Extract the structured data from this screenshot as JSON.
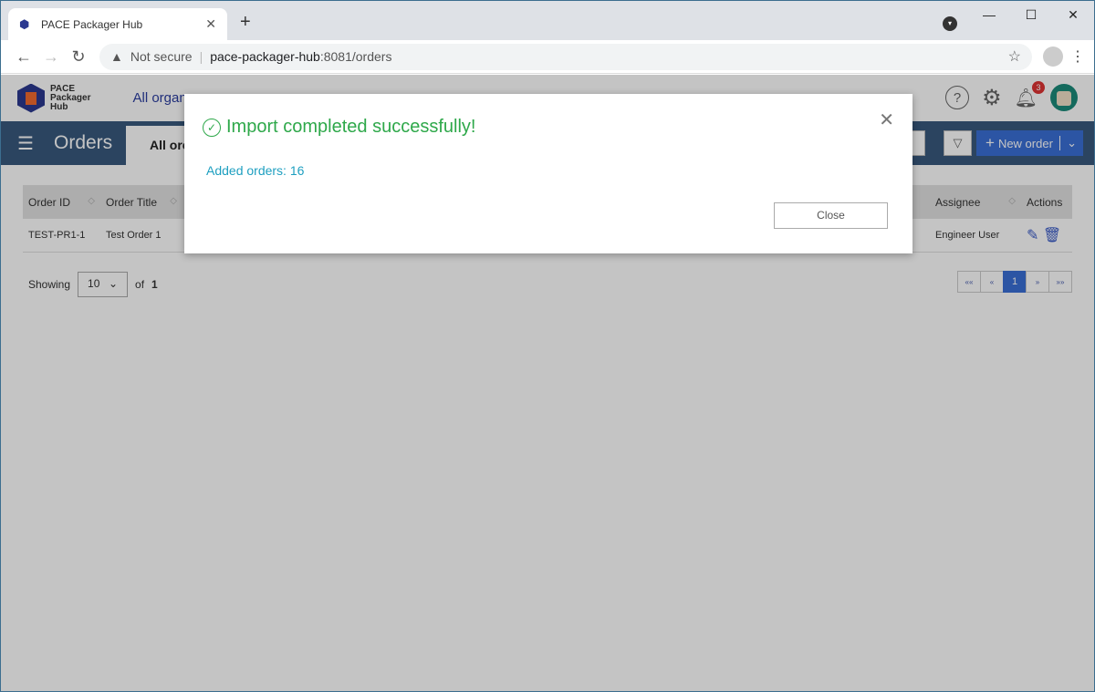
{
  "browser": {
    "tab_title": "PACE Packager Hub",
    "not_secure": "Not secure",
    "url_host": "pace-packager-hub",
    "url_rest": ":8081/orders"
  },
  "app": {
    "logo_line1": "PACE",
    "logo_line2": "Packager",
    "logo_line3": "Hub",
    "org_selector": "All organ",
    "notification_count": "3",
    "page_title": "Orders",
    "tab_all": "All orc",
    "new_order": "New order"
  },
  "table": {
    "headers": [
      "Order ID",
      "Order Title",
      "Assignee",
      "Actions"
    ],
    "rows": [
      {
        "id": "TEST-PR1-1",
        "title": "Test Order 1",
        "assignee": "Engineer User"
      }
    ]
  },
  "footer": {
    "showing": "Showing",
    "page_size": "10",
    "of": "of",
    "total_pages": "1"
  },
  "pager": {
    "first": "««",
    "prev": "«",
    "current": "1",
    "next": "»",
    "last": "»»"
  },
  "modal": {
    "title": "Import completed successfully!",
    "message": "Added orders: 16",
    "close": "Close"
  },
  "colors": {
    "success": "#2ea84a",
    "info": "#1e9fc0",
    "primary": "#3a6fd6",
    "header": "#38597d"
  }
}
